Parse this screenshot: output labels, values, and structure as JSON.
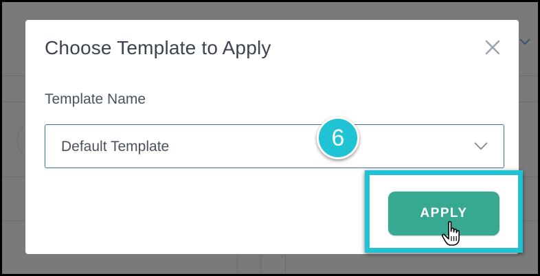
{
  "modal": {
    "title": "Choose Template to Apply",
    "field_label": "Template Name",
    "select_value": "Default Template",
    "apply_label": "APPLY"
  },
  "annotation": {
    "step_number": "6",
    "accent_color": "#1fc3d3"
  },
  "icons": {
    "close": "close-icon",
    "dropdown": "chevron-down-icon",
    "cursor": "hand-pointer-icon"
  },
  "colors": {
    "apply_button": "#37a892",
    "select_border": "#3d6fa3",
    "overlay": "#7a7a7a"
  }
}
